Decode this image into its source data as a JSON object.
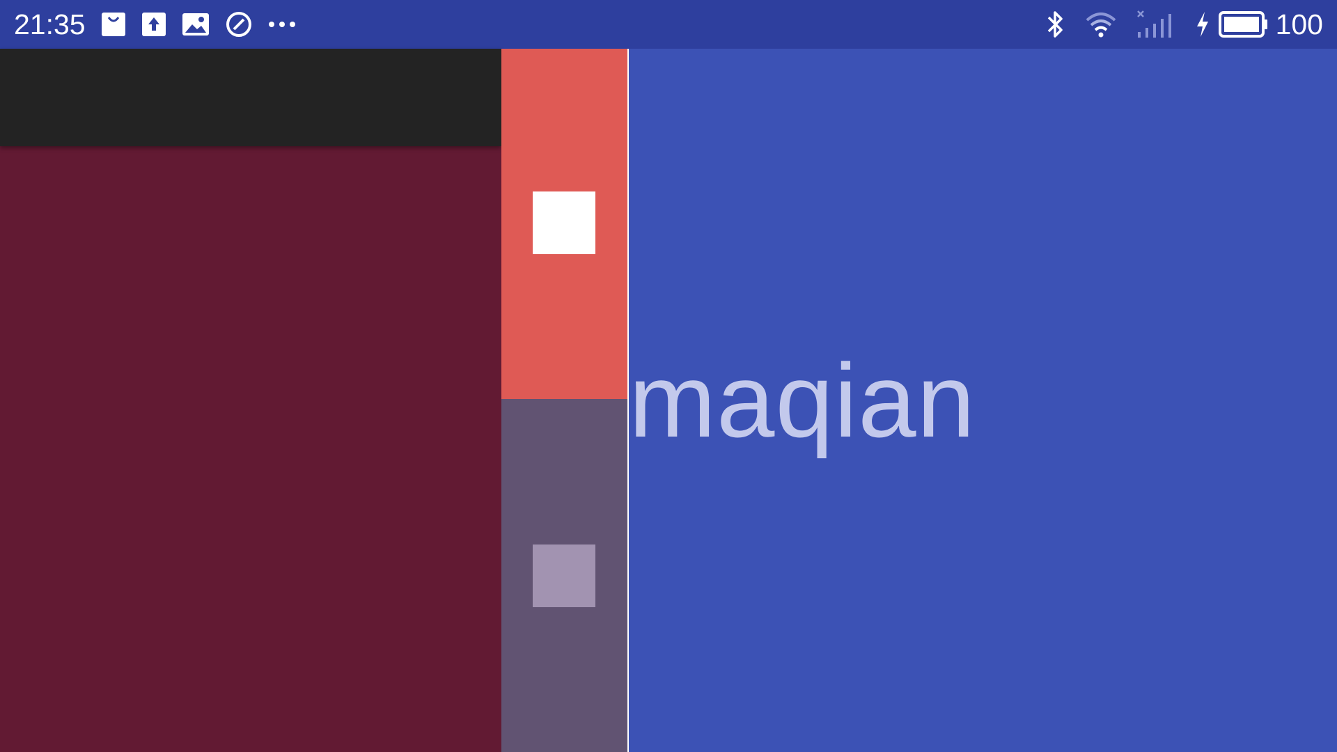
{
  "status_bar": {
    "time": "21:35",
    "left_icons": [
      "shopping-bag-icon",
      "upload-icon",
      "image-icon",
      "do-not-disturb-icon",
      "more-dots-icon"
    ],
    "right_icons": [
      "bluetooth-icon",
      "wifi-icon",
      "signal-no-service-icon",
      "charging-icon",
      "battery-icon"
    ],
    "battery_level": "100"
  },
  "colors": {
    "status_bar": "#2e3f9e",
    "left_toolbar": "#232323",
    "left_panel": "#621a33",
    "strip_top": "#df5a55",
    "strip_bottom": "#615372",
    "main": "#3c52b5",
    "main_text": "#c3c9ec"
  },
  "main": {
    "text": "maqian"
  }
}
